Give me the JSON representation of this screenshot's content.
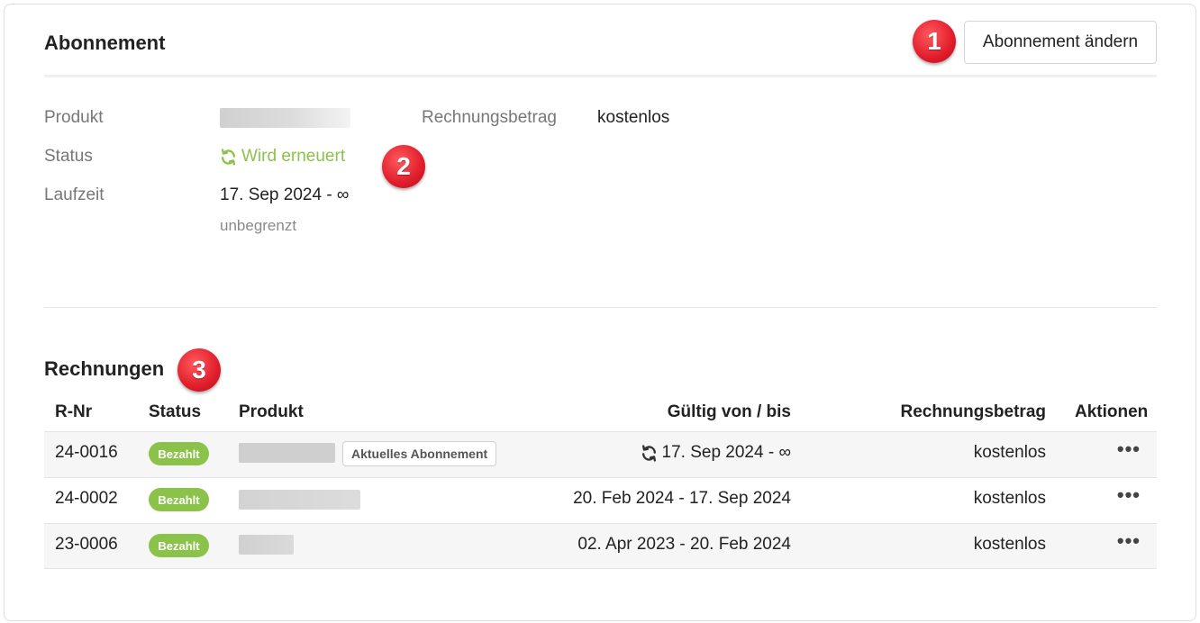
{
  "subscription": {
    "title": "Abonnement",
    "change_button": "Abonnement ändern",
    "product_label": "Produkt",
    "status_label": "Status",
    "status_value": "Wird erneuert",
    "runtime_label": "Laufzeit",
    "runtime_value": "17. Sep 2024 - ∞",
    "runtime_note": "unbegrenzt",
    "amount_label": "Rechnungsbetrag",
    "amount_value": "kostenlos"
  },
  "markers": [
    "1",
    "2",
    "3"
  ],
  "invoices": {
    "title": "Rechnungen",
    "columns": {
      "number": "R-Nr",
      "status": "Status",
      "product": "Produkt",
      "validity": "Gültig von / bis",
      "amount": "Rechnungsbetrag",
      "actions": "Aktionen"
    },
    "rows": [
      {
        "number": "24-0016",
        "status": "Bezahlt",
        "tag": "Aktuelles Abonnement",
        "validity": "17. Sep 2024 - ∞",
        "amount": "kostenlos",
        "actions": "•••"
      },
      {
        "number": "24-0002",
        "status": "Bezahlt",
        "validity": "20. Feb 2024 - 17. Sep 2024",
        "amount": "kostenlos",
        "actions": "•••"
      },
      {
        "number": "23-0006",
        "status": "Bezahlt",
        "validity": "02. Apr 2023 - 20. Feb 2024",
        "amount": "kostenlos",
        "actions": "•••"
      }
    ]
  },
  "colors": {
    "accent_green": "#8bc34a",
    "marker_red": "#e11d2b"
  },
  "icons": {
    "renew": "refresh-icon",
    "more": "more-horizontal-icon"
  }
}
